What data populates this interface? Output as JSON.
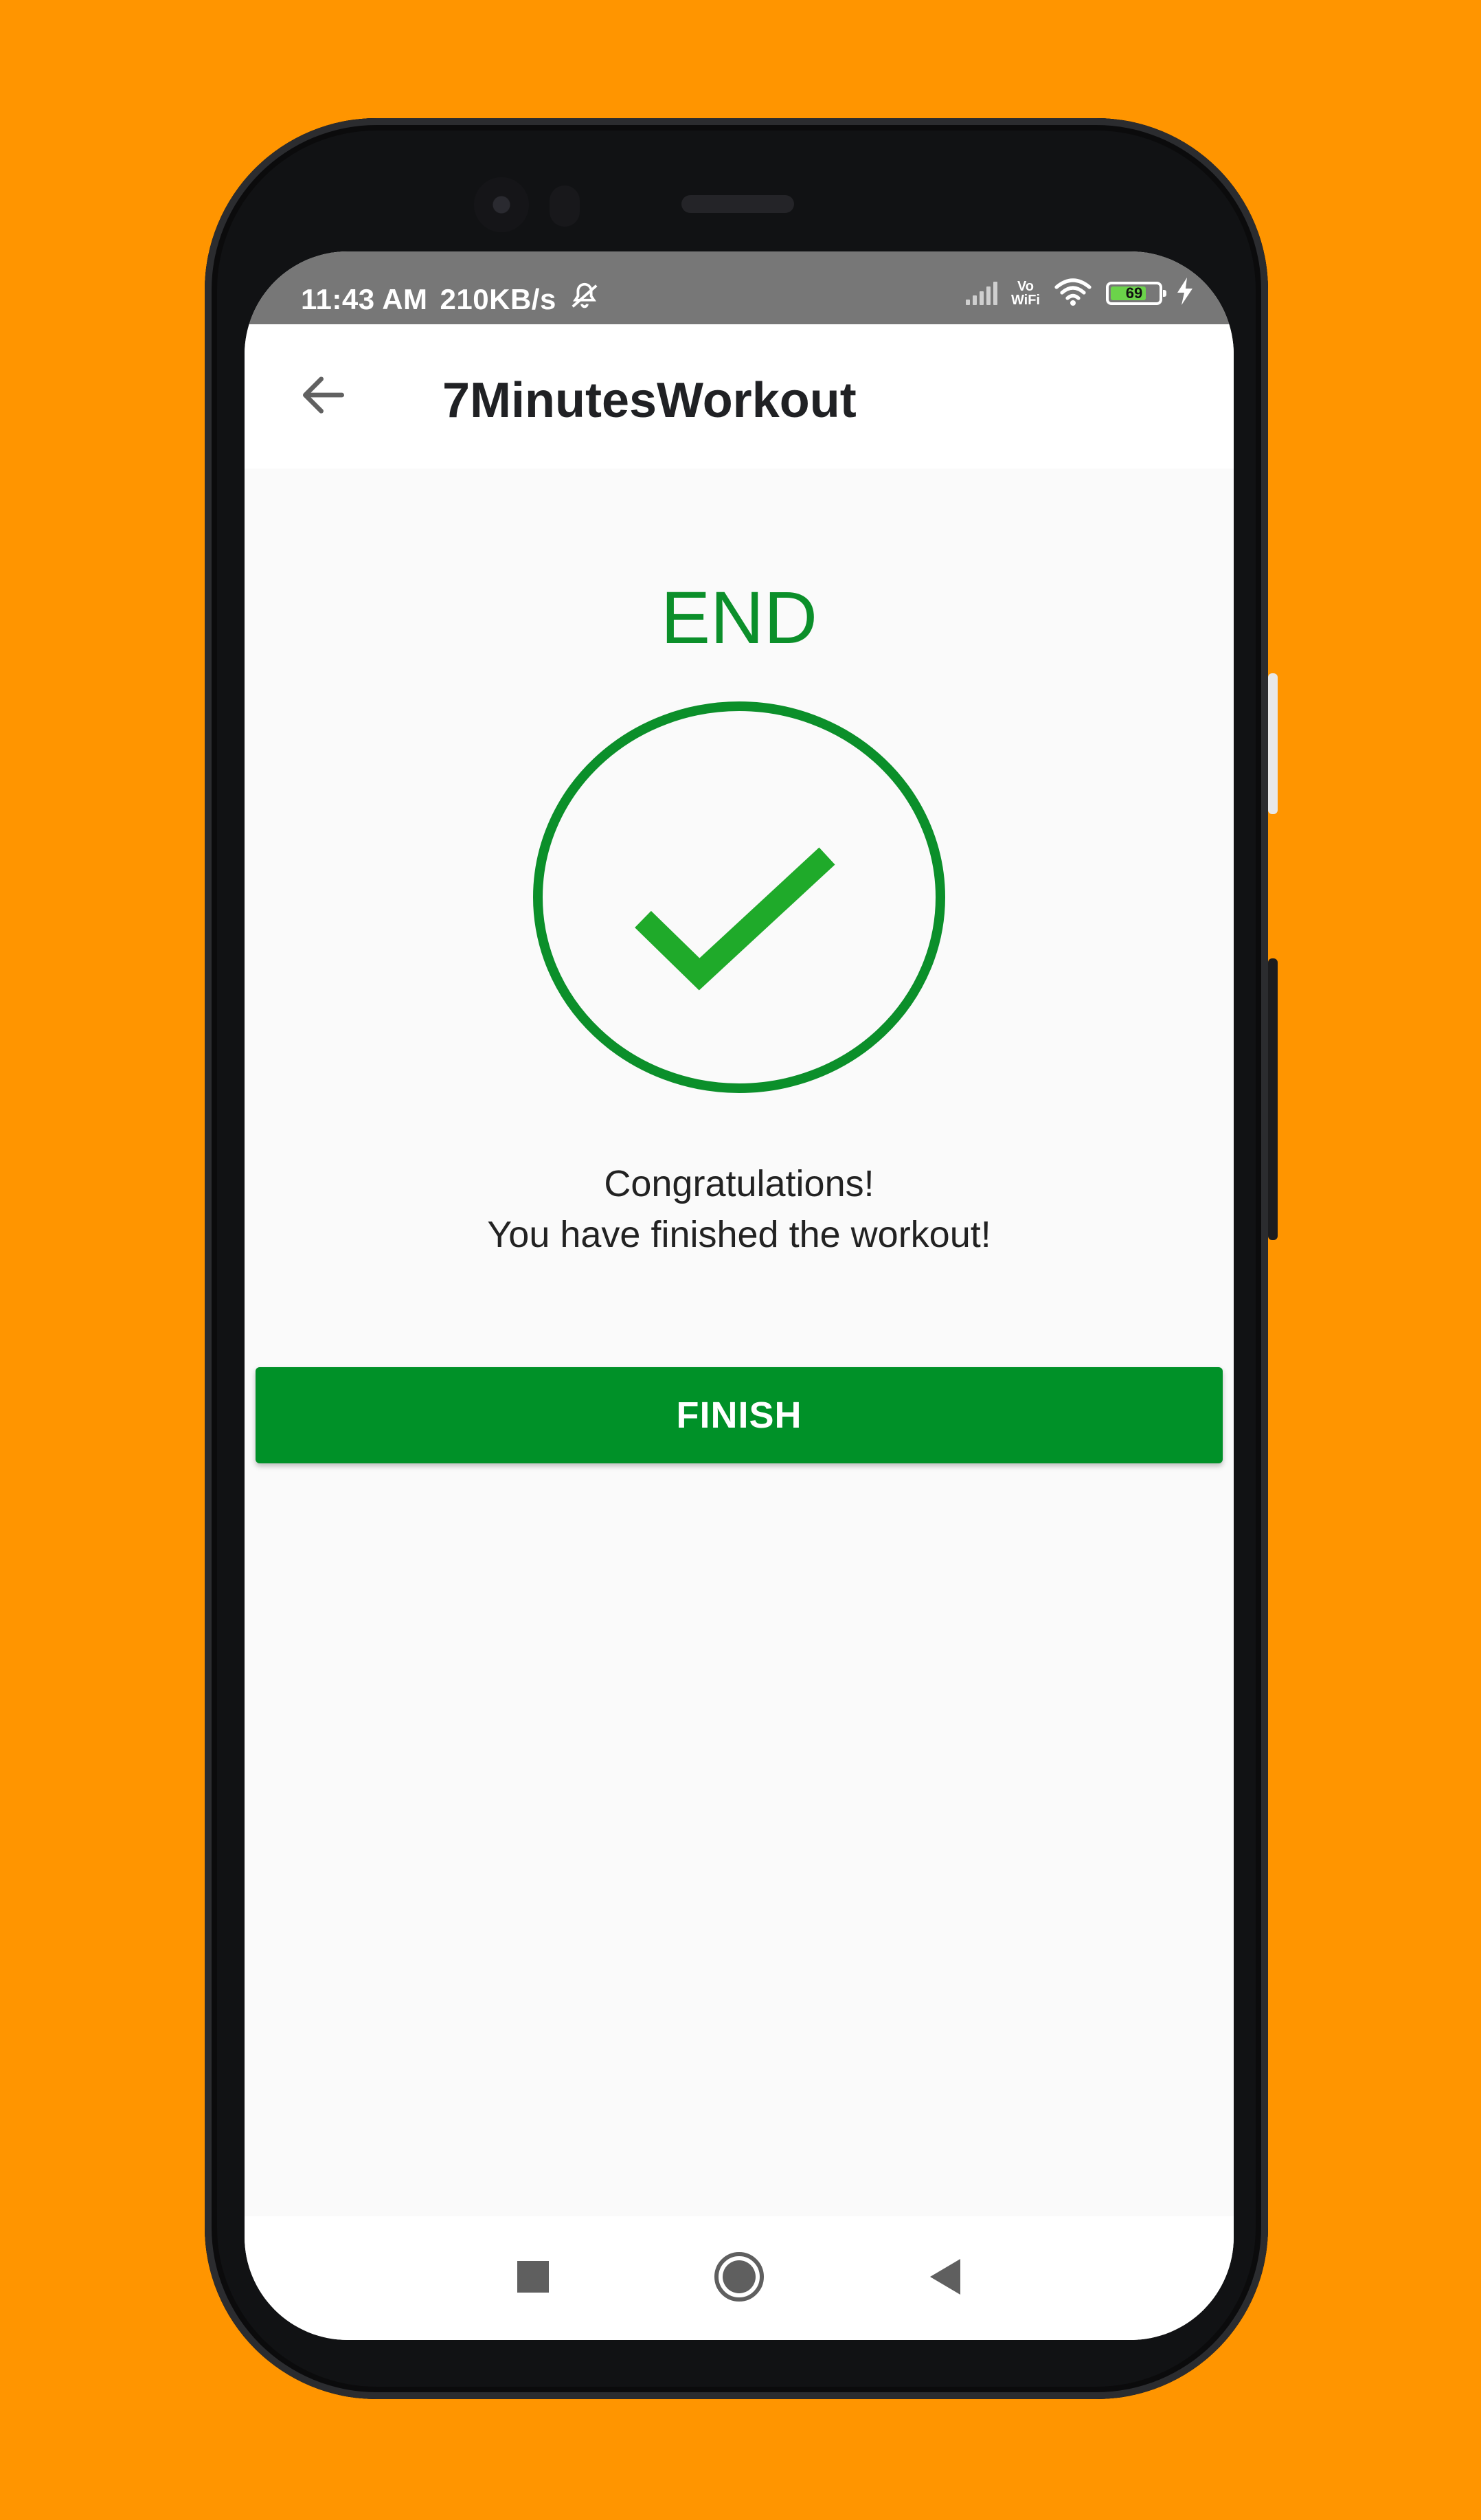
{
  "status_bar": {
    "time": "11:43 AM",
    "speed": "210KB/s",
    "network_label_top": "Vo",
    "network_label_bottom": "WiFi",
    "battery_level": "69"
  },
  "app_bar": {
    "title": "7MinutesWorkout"
  },
  "main": {
    "heading": "END",
    "message_line1": "Congratulations!",
    "message_line2": "You have finished the workout!",
    "finish_label": "FINISH"
  },
  "colors": {
    "accent_green": "#009128",
    "heading_green": "#0b8f2a",
    "check_green": "#1faa2a",
    "background": "#FF9500"
  },
  "icons": {
    "back": "arrow-left-icon",
    "check": "check-circle-icon",
    "nav_recent": "square-icon",
    "nav_home": "circle-icon",
    "nav_back": "triangle-back-icon"
  }
}
